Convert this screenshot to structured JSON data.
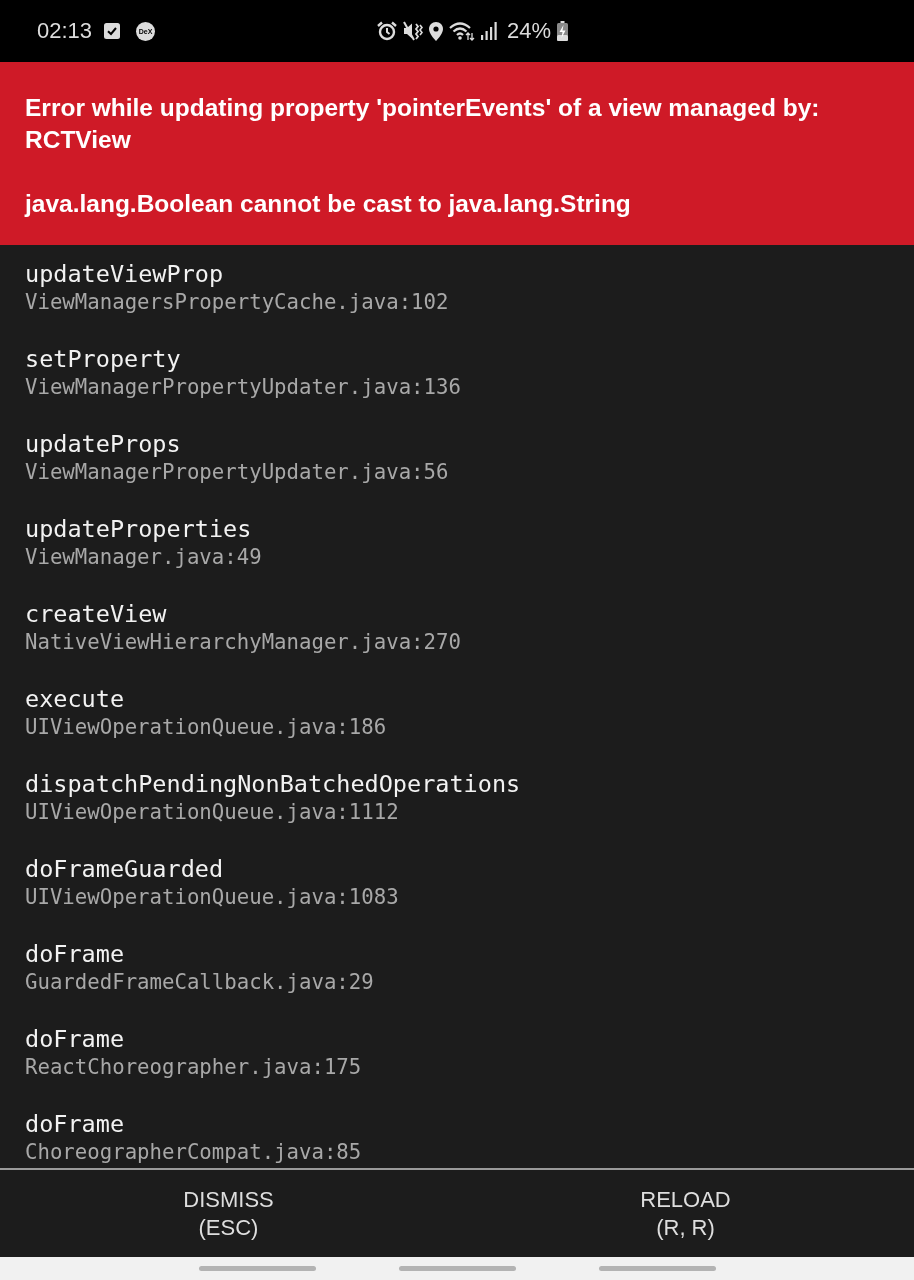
{
  "status_bar": {
    "time": "02:13",
    "dex_label": "DeX",
    "battery": "24%"
  },
  "error": {
    "message": "Error while updating property 'pointerEvents' of a view managed by: RCTView\n\njava.lang.Boolean cannot be cast to java.lang.String"
  },
  "stack": [
    {
      "method": "updateViewProp",
      "file": "ViewManagersPropertyCache.java:102"
    },
    {
      "method": "setProperty",
      "file": "ViewManagerPropertyUpdater.java:136"
    },
    {
      "method": "updateProps",
      "file": "ViewManagerPropertyUpdater.java:56"
    },
    {
      "method": "updateProperties",
      "file": "ViewManager.java:49"
    },
    {
      "method": "createView",
      "file": "NativeViewHierarchyManager.java:270"
    },
    {
      "method": "execute",
      "file": "UIViewOperationQueue.java:186"
    },
    {
      "method": "dispatchPendingNonBatchedOperations",
      "file": "UIViewOperationQueue.java:1112"
    },
    {
      "method": "doFrameGuarded",
      "file": "UIViewOperationQueue.java:1083"
    },
    {
      "method": "doFrame",
      "file": "GuardedFrameCallback.java:29"
    },
    {
      "method": "doFrame",
      "file": "ReactChoreographer.java:175"
    },
    {
      "method": "doFrame",
      "file": "ChoreographerCompat.java:85"
    }
  ],
  "buttons": [
    {
      "label": "DISMISS\n(ESC)"
    },
    {
      "label": "RELOAD\n(R, R)"
    }
  ]
}
